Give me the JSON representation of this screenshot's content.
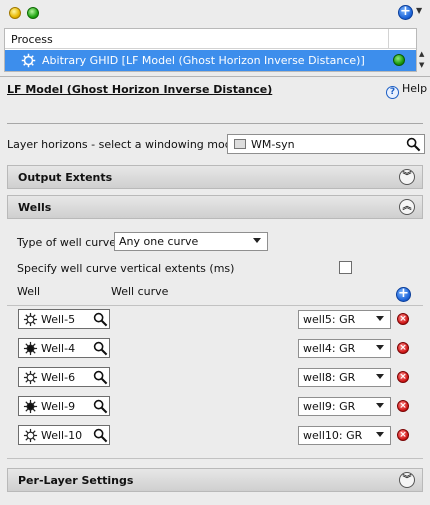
{
  "topbar": {
    "add_icon": "plus-circle-icon"
  },
  "process": {
    "header": "Process",
    "row_label": "Abitrary GHID [LF Model (Ghost Horizon Inverse Distance)]",
    "status_color": "#1c9c10",
    "row_icon": "gear-icon"
  },
  "model": {
    "title": "LF Model (Ghost Horizon Inverse Distance)",
    "help_label": "Help"
  },
  "layer": {
    "label": "Layer horizons - select a windowing model",
    "value": "WM-syn"
  },
  "sections": {
    "output_extents": "Output Extents",
    "wells": "Wells",
    "per_layer": "Per-Layer Settings"
  },
  "wells": {
    "type_label": "Type of well curves",
    "type_value": "Any one curve",
    "vertical_label": "Specify well curve vertical extents (ms)",
    "vertical_checked": false,
    "col_well": "Well",
    "col_curve": "Well curve",
    "rows": [
      {
        "well": "Well-5",
        "curve": "well5: GR"
      },
      {
        "well": "Well-4",
        "curve": "well4: GR"
      },
      {
        "well": "Well-6",
        "curve": "well8: GR"
      },
      {
        "well": "Well-9",
        "curve": "well9: GR"
      },
      {
        "well": "Well-10",
        "curve": "well10: GR"
      }
    ]
  }
}
